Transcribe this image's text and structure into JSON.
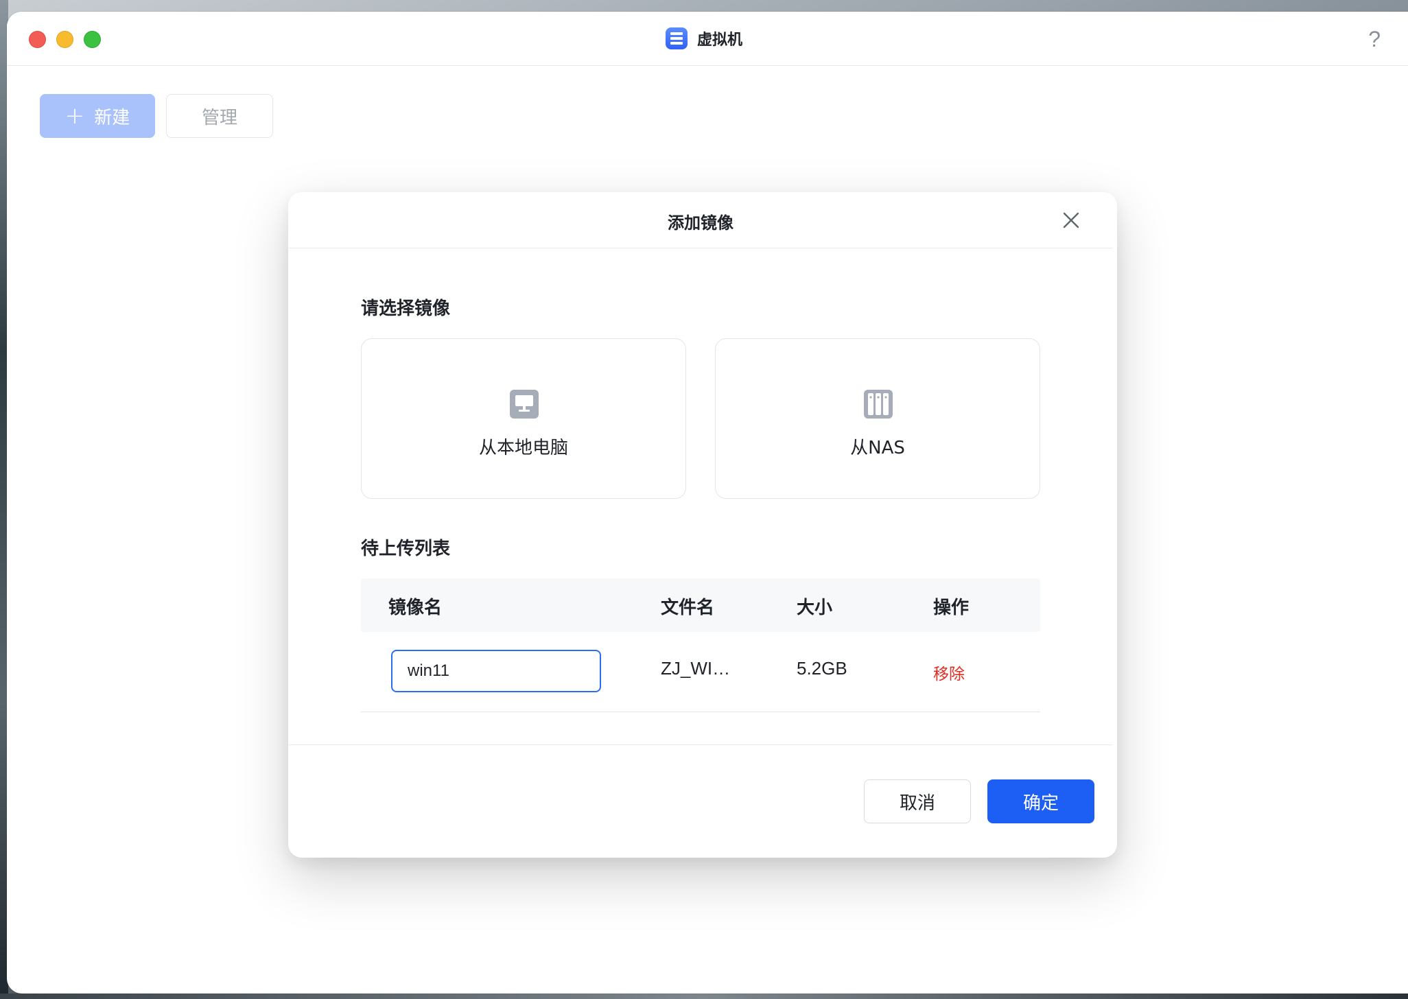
{
  "window": {
    "title": "虚拟机",
    "help_symbol": "?"
  },
  "toolbar": {
    "new_plus": "+",
    "new_label": "新建",
    "manage_label": "管理"
  },
  "dialog": {
    "title": "添加镜像",
    "select_section_title": "请选择镜像",
    "sources": [
      {
        "label": "从本地电脑",
        "icon": "computer-icon"
      },
      {
        "label": "从NAS",
        "icon": "nas-icon"
      }
    ],
    "upload_section_title": "待上传列表",
    "table": {
      "headers": [
        "镜像名",
        "文件名",
        "大小",
        "操作"
      ],
      "rows": [
        {
          "image_name": "win11",
          "file_name": "ZJ_WI…",
          "size": "5.2GB",
          "action": "移除"
        }
      ]
    },
    "cancel_label": "取消",
    "ok_label": "确定"
  },
  "colors": {
    "primary": "#1d5ff5",
    "primary_disabled": "#a9c2fb",
    "danger": "#e02e24",
    "icon_gray": "#a7adb8"
  }
}
